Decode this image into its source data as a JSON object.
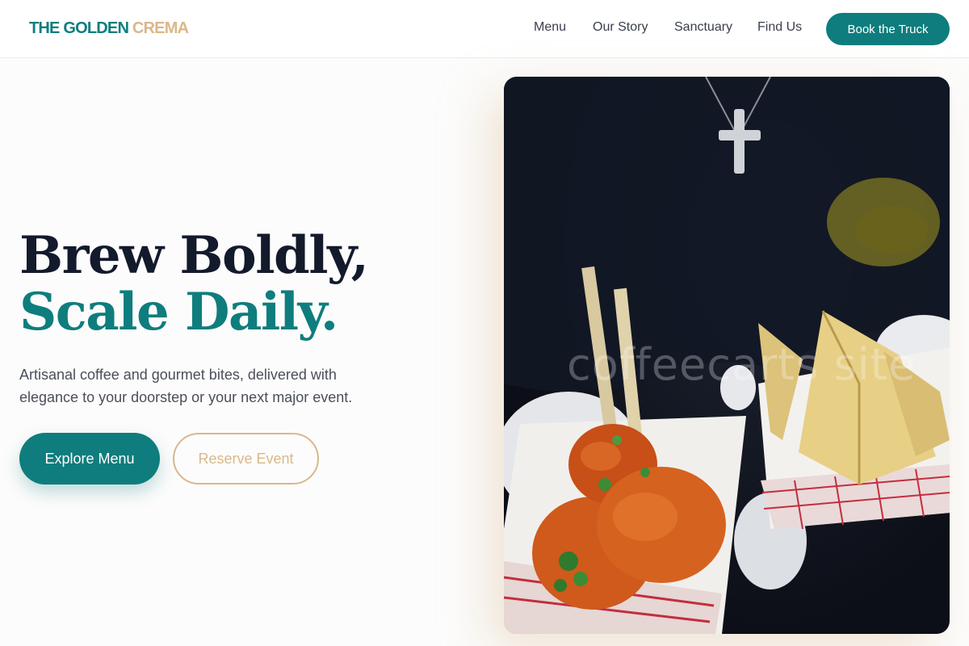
{
  "brand": {
    "name_part1": "THE GOLDEN",
    "name_part2": "CREMA"
  },
  "nav": {
    "items": [
      {
        "label": "Menu"
      },
      {
        "label": "Our Story"
      },
      {
        "label": "Sanctuary"
      },
      {
        "label": "Find Us"
      }
    ],
    "cta_label": "Book the Truck"
  },
  "hero": {
    "title_line1": "Brew Boldly,",
    "title_line2": "Scale Daily.",
    "subtitle": "Artisanal coffee and gourmet bites, delivered with elegance to your doorstep or your next major event.",
    "primary_button": "Explore Menu",
    "secondary_button": "Reserve Event",
    "image_watermark": "coffeecarts site"
  },
  "colors": {
    "accent_teal": "#0f7d7d",
    "accent_gold": "#d9b88a",
    "heading_dark": "#131a2c"
  }
}
